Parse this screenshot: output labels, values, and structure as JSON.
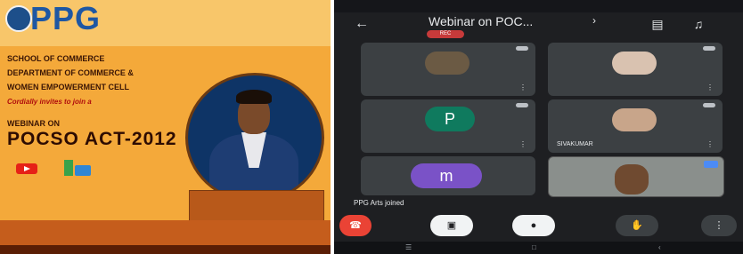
{
  "poster": {
    "logo_text": "PPG",
    "logo_sub": "",
    "top_right_note": "",
    "dept_lines": [
      "SCHOOL OF COMMERCE",
      "DEPARTMENT OF COMMERCE &",
      "WOMEN EMPOWERMENT CELL"
    ],
    "invite": "Cordially invites to join a",
    "webinar_on": "WEBINAR ON",
    "event_title": "POCSO ACT-2012",
    "date": "",
    "time": "",
    "speaker_name": "",
    "speaker_role": "",
    "speaker_org": "",
    "footer_cols": [
      "",
      "",
      ""
    ],
    "social": ""
  },
  "phone": {
    "status": {
      "left": "",
      "mid": "",
      "right": ""
    },
    "meeting_title": "Webinar on POC...",
    "rec_badge": "REC",
    "tiles": [
      {
        "name": "",
        "avatar": "photo"
      },
      {
        "name": "",
        "avatar": "photo"
      },
      {
        "name": "",
        "avatar": "letter",
        "letter": "P"
      },
      {
        "name": "SIVAKUMAR",
        "avatar": "photo"
      },
      {
        "name": "",
        "avatar": "letter",
        "letter": "m"
      }
    ],
    "join_toast": "PPG Arts joined",
    "controls": {
      "end": "",
      "camera": "",
      "mic": "",
      "hand": "",
      "more": ""
    },
    "nav": {
      "back": "",
      "home": "",
      "recents": ""
    }
  },
  "colors": {
    "poster_bg": "#f4a93a",
    "brand_blue": "#1e57a3",
    "call_bg": "#1e1f22",
    "end_red": "#ea4335"
  },
  "icons": [
    "back-arrow-icon",
    "switch-camera-icon",
    "audio-output-icon",
    "mic-icon",
    "end-call-icon",
    "camera-icon",
    "raise-hand-icon",
    "more-icon",
    "youtube-icon",
    "google-meet-icon"
  ]
}
